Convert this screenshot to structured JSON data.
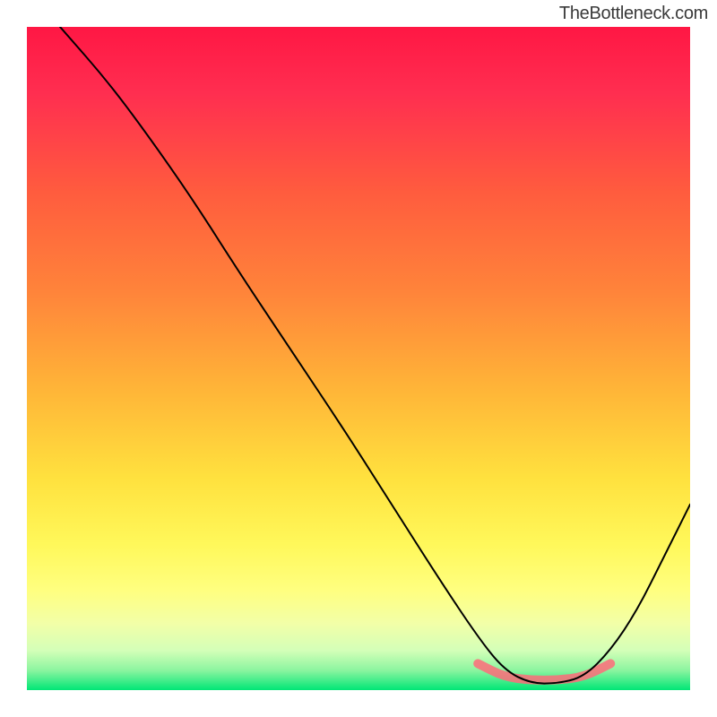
{
  "watermark": "TheBottleneck.com",
  "chart_data": {
    "type": "line",
    "title": "",
    "xlabel": "",
    "ylabel": "",
    "xlim": [
      0,
      100
    ],
    "ylim": [
      0,
      100
    ],
    "gradient_stops": [
      {
        "offset": 0,
        "color": "#ff1744"
      },
      {
        "offset": 10,
        "color": "#ff2e50"
      },
      {
        "offset": 25,
        "color": "#ff5c3e"
      },
      {
        "offset": 40,
        "color": "#ff843a"
      },
      {
        "offset": 55,
        "color": "#ffb638"
      },
      {
        "offset": 68,
        "color": "#ffe13e"
      },
      {
        "offset": 78,
        "color": "#fff85a"
      },
      {
        "offset": 85,
        "color": "#ffff80"
      },
      {
        "offset": 90,
        "color": "#f2ffa8"
      },
      {
        "offset": 94,
        "color": "#d4ffb8"
      },
      {
        "offset": 97,
        "color": "#8cf5a0"
      },
      {
        "offset": 100,
        "color": "#00e676"
      }
    ],
    "series": [
      {
        "name": "curve",
        "color": "#000000",
        "stroke_width": 2,
        "points": [
          {
            "x": 5,
            "y": 100
          },
          {
            "x": 12,
            "y": 92
          },
          {
            "x": 18,
            "y": 84
          },
          {
            "x": 25,
            "y": 74
          },
          {
            "x": 32,
            "y": 63
          },
          {
            "x": 40,
            "y": 51
          },
          {
            "x": 48,
            "y": 39
          },
          {
            "x": 55,
            "y": 28
          },
          {
            "x": 62,
            "y": 17
          },
          {
            "x": 68,
            "y": 8
          },
          {
            "x": 72,
            "y": 3
          },
          {
            "x": 76,
            "y": 1
          },
          {
            "x": 80,
            "y": 1
          },
          {
            "x": 84,
            "y": 2
          },
          {
            "x": 88,
            "y": 6
          },
          {
            "x": 92,
            "y": 12
          },
          {
            "x": 96,
            "y": 20
          },
          {
            "x": 100,
            "y": 28
          }
        ]
      },
      {
        "name": "highlight-band",
        "color": "#ff6b7a",
        "stroke_width": 10,
        "points": [
          {
            "x": 68,
            "y": 4
          },
          {
            "x": 72,
            "y": 2
          },
          {
            "x": 76,
            "y": 1.5
          },
          {
            "x": 80,
            "y": 1.5
          },
          {
            "x": 84,
            "y": 2
          },
          {
            "x": 88,
            "y": 4
          }
        ]
      }
    ]
  }
}
